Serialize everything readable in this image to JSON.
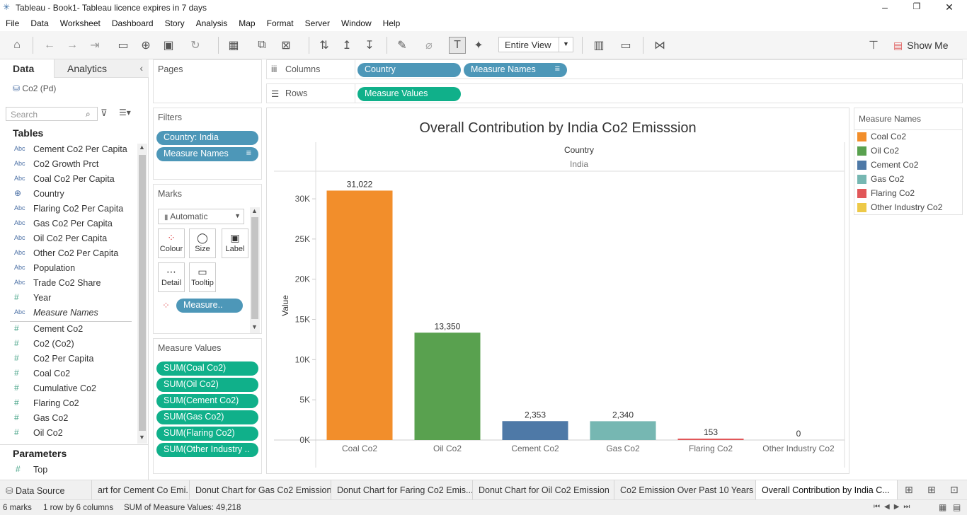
{
  "window": {
    "title": "Tableau - Book1- Tableau licence expires in 7 days"
  },
  "menu": [
    "File",
    "Data",
    "Worksheet",
    "Dashboard",
    "Story",
    "Analysis",
    "Map",
    "Format",
    "Server",
    "Window",
    "Help"
  ],
  "toolbar": {
    "view_select": "Entire View",
    "show_me": "Show Me"
  },
  "data_pane": {
    "tabs": [
      "Data",
      "Analytics"
    ],
    "datasource": "Co2 (Pd)",
    "search_placeholder": "Search",
    "tables_heading": "Tables",
    "dimensions": [
      {
        "type": "Abc",
        "name": "Cement Co2 Per Capita"
      },
      {
        "type": "Abc",
        "name": "Co2 Growth Prct"
      },
      {
        "type": "Abc",
        "name": "Coal Co2 Per Capita"
      },
      {
        "type": "globe",
        "name": "Country"
      },
      {
        "type": "Abc",
        "name": "Flaring Co2 Per Capita"
      },
      {
        "type": "Abc",
        "name": "Gas Co2 Per Capita"
      },
      {
        "type": "Abc",
        "name": "Oil Co2 Per Capita"
      },
      {
        "type": "Abc",
        "name": "Other Co2 Per Capita"
      },
      {
        "type": "Abc",
        "name": "Population"
      },
      {
        "type": "Abc",
        "name": "Trade Co2 Share"
      },
      {
        "type": "#",
        "name": "Year"
      },
      {
        "type": "Abc",
        "name": "Measure Names"
      }
    ],
    "measures": [
      {
        "type": "#",
        "name": "Cement Co2"
      },
      {
        "type": "#",
        "name": "Co2 (Co2)"
      },
      {
        "type": "#",
        "name": "Co2 Per Capita"
      },
      {
        "type": "#",
        "name": "Coal Co2"
      },
      {
        "type": "#",
        "name": "Cumulative Co2"
      },
      {
        "type": "#",
        "name": "Flaring Co2"
      },
      {
        "type": "#",
        "name": "Gas Co2"
      },
      {
        "type": "#",
        "name": "Oil Co2"
      }
    ],
    "parameters_heading": "Parameters",
    "parameters": [
      {
        "type": "#",
        "name": "Top"
      }
    ]
  },
  "shelves": {
    "pages": "Pages",
    "filters_title": "Filters",
    "filters": [
      "Country: India",
      "Measure Names"
    ],
    "marks_title": "Marks",
    "mark_type": "Automatic",
    "mark_buttons": [
      "Colour",
      "Size",
      "Label",
      "Detail",
      "Tooltip"
    ],
    "mark_pill": "Measure..",
    "measure_values_title": "Measure Values",
    "measure_values": [
      "SUM(Coal Co2)",
      "SUM(Oil Co2)",
      "SUM(Cement Co2)",
      "SUM(Gas Co2)",
      "SUM(Flaring Co2)",
      "SUM(Other Industry .."
    ],
    "columns_label": "Columns",
    "columns": [
      "Country",
      "Measure Names"
    ],
    "rows_label": "Rows",
    "rows": [
      "Measure Values"
    ]
  },
  "chart_data": {
    "type": "bar",
    "title": "Overall Contribution by India Co2 Emisssion",
    "header_field": "Country",
    "header_value": "India",
    "ylabel": "Value",
    "xlabel": "",
    "categories": [
      "Coal Co2",
      "Oil Co2",
      "Cement Co2",
      "Gas Co2",
      "Flaring Co2",
      "Other Industry Co2"
    ],
    "values": [
      31022,
      13350,
      2353,
      2340,
      153,
      0
    ],
    "value_labels": [
      "31,022",
      "13,350",
      "2,353",
      "2,340",
      "153",
      "0"
    ],
    "colors": [
      "#f28e2b",
      "#59a14f",
      "#4e79a7",
      "#76b7b2",
      "#e15759",
      "#edc948"
    ],
    "yticks": [
      0,
      5000,
      10000,
      15000,
      20000,
      25000,
      30000
    ],
    "ytick_labels": [
      "0K",
      "5K",
      "10K",
      "15K",
      "20K",
      "25K",
      "30K"
    ],
    "ylim": [
      0,
      31500
    ],
    "grid": false
  },
  "legend": {
    "title": "Measure Names",
    "items": [
      {
        "label": "Coal Co2",
        "color": "#f28e2b"
      },
      {
        "label": "Oil Co2",
        "color": "#59a14f"
      },
      {
        "label": "Cement Co2",
        "color": "#4e79a7"
      },
      {
        "label": "Gas Co2",
        "color": "#76b7b2"
      },
      {
        "label": "Flaring Co2",
        "color": "#e15759"
      },
      {
        "label": "Other Industry Co2",
        "color": "#edc948"
      }
    ]
  },
  "sheet_tabs": {
    "data_source": "Data Source",
    "tabs": [
      "art for Cement Co Emi...",
      "Donut Chart for Gas Co2 Emission",
      "Donut Chart for Faring Co2 Emis...",
      "Donut Chart for Oil Co2 Emission",
      "Co2 Emission Over Past 10 Years",
      "Overall Contribution by India C..."
    ],
    "active_index": 5
  },
  "status": {
    "marks": "6 marks",
    "dims": "1 row by 6 columns",
    "sum": "SUM of Measure Values: 49,218"
  }
}
